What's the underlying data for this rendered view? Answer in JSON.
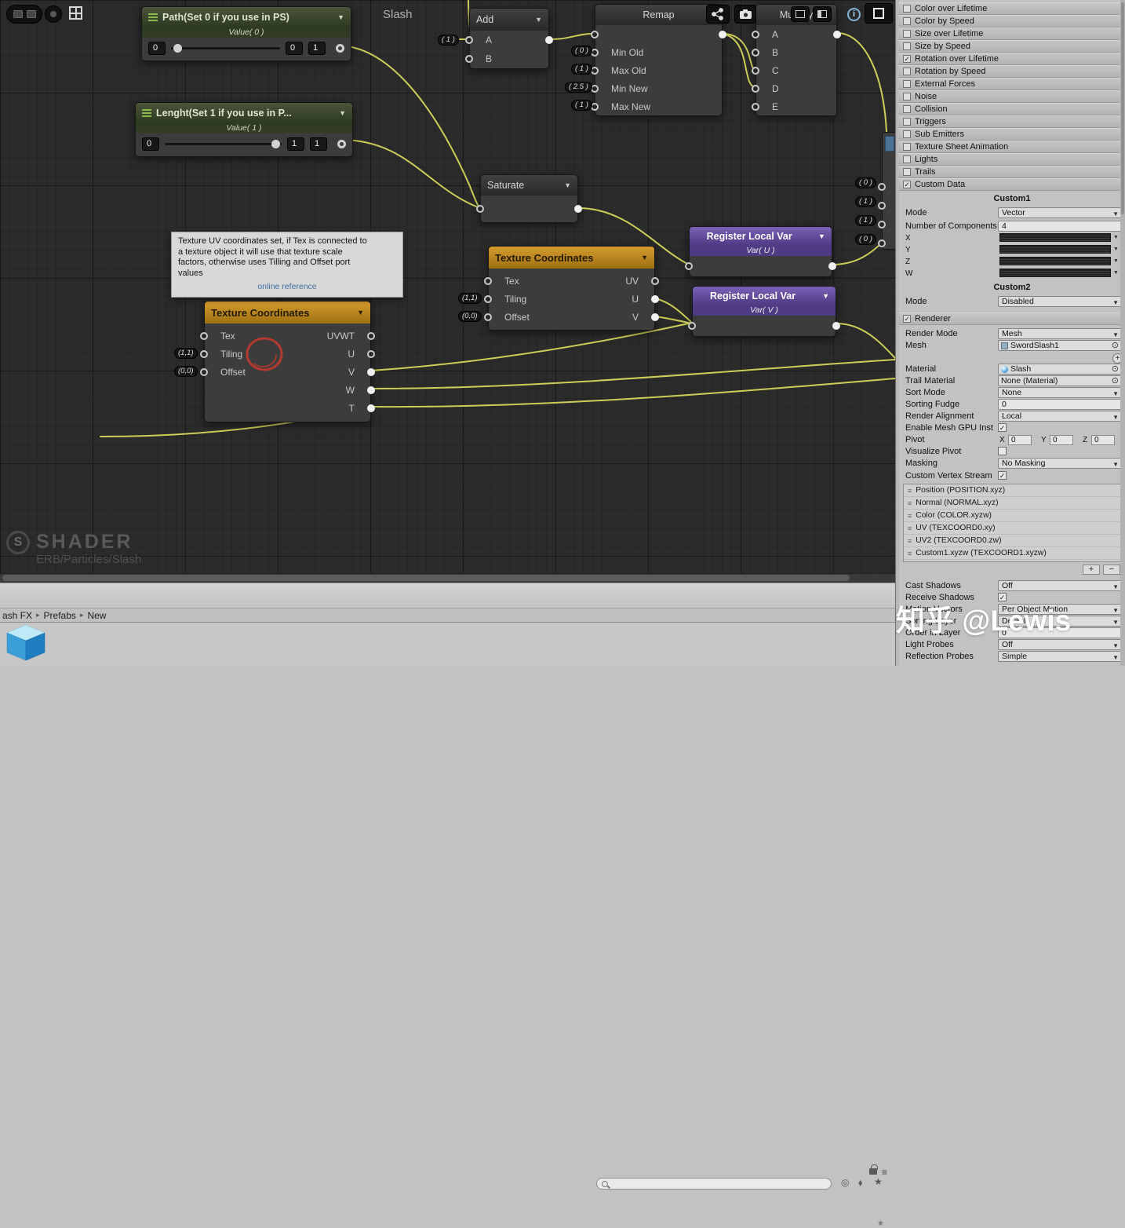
{
  "canvas": {
    "title": "Slash",
    "watermark": {
      "logo": "S",
      "title": "SHADER",
      "subtitle": "ERB/Particles/Slash"
    },
    "tooltip": {
      "line1": "Texture UV coordinates set, if Tex is connected to",
      "line2": "a texture object it will use that texture scale",
      "line3": "factors, otherwise uses Tilling and Offset port",
      "line4": "values",
      "link": "online reference"
    },
    "nodes": {
      "path": {
        "title": "Path(Set 0 if you use in PS)",
        "subtitle": "Value( 0 )",
        "v1": "0",
        "v2": "0",
        "v3": "1"
      },
      "length": {
        "title": "Lenght(Set 1 if you use in P...",
        "subtitle": "Value( 1 )",
        "v1": "0",
        "v2": "1",
        "v3": "1"
      },
      "add": {
        "title": "Add",
        "in1": "A",
        "in2": "B",
        "badge": "( 1 )"
      },
      "remap": {
        "title": "Remap",
        "in1": "Min Old",
        "in2": "Max Old",
        "in3": "Min New",
        "in4": "Max New",
        "b1": "( 0 )",
        "b2": "( 1 )",
        "b3": "( 2.5 )",
        "b4": "( 1 )"
      },
      "multiply": {
        "title": "Multiply",
        "in1": "A",
        "in2": "B",
        "in3": "C",
        "in4": "D",
        "in5": "E"
      },
      "saturate": {
        "title": "Saturate"
      },
      "tex_small": {
        "title": "Texture Coordinates",
        "in1": "Tex",
        "in2": "Tiling",
        "in3": "Offset",
        "out1": "UV",
        "out2": "U",
        "out3": "V",
        "b1": "(1,1)",
        "b2": "(0,0)"
      },
      "tex_large": {
        "title": "Texture Coordinates",
        "in1": "Tex",
        "in2": "Tiling",
        "in3": "Offset",
        "out1": "UVWT",
        "out2": "U",
        "out3": "V",
        "out4": "W",
        "out5": "T",
        "b1": "(1,1)",
        "b2": "(0,0)"
      },
      "reg_u": {
        "title": "Register Local Var",
        "subtitle": "Var( U )"
      },
      "reg_v": {
        "title": "Register Local Var",
        "subtitle": "Var( V )"
      },
      "side": {
        "b1": "( 0 )",
        "b2": "( 1 )",
        "b3": "( 1 )",
        "b4": "( 0 )"
      }
    }
  },
  "inspector": {
    "modules": [
      {
        "label": "Color over Lifetime",
        "check": ""
      },
      {
        "label": "Color by Speed",
        "check": ""
      },
      {
        "label": "Size over Lifetime",
        "check": ""
      },
      {
        "label": "Size by Speed",
        "check": ""
      },
      {
        "label": "Rotation over Lifetime",
        "check": "✓"
      },
      {
        "label": "Rotation by Speed",
        "check": ""
      },
      {
        "label": "External Forces",
        "check": ""
      },
      {
        "label": "Noise",
        "check": ""
      },
      {
        "label": "Collision",
        "check": ""
      },
      {
        "label": "Triggers",
        "check": ""
      },
      {
        "label": "Sub Emitters",
        "check": ""
      },
      {
        "label": "Texture Sheet Animation",
        "check": ""
      },
      {
        "label": "Lights",
        "check": ""
      },
      {
        "label": "Trails",
        "check": ""
      },
      {
        "label": "Custom Data",
        "check": "✓"
      }
    ],
    "custom_data": {
      "custom1_title": "Custom1",
      "mode1_label": "Mode",
      "mode1_value": "Vector",
      "components_label": "Number of Components",
      "components_value": "4",
      "x_label": "X",
      "y_label": "Y",
      "z_label": "Z",
      "w_label": "W",
      "custom2_title": "Custom2",
      "mode2_label": "Mode",
      "mode2_value": "Disabled"
    },
    "renderer": {
      "title": "Renderer",
      "check": "✓",
      "render_mode_label": "Render Mode",
      "render_mode_value": "Mesh",
      "mesh_label": "Mesh",
      "mesh_value": "SwordSlash1",
      "material_label": "Material",
      "material_value": "Slash",
      "trail_material_label": "Trail Material",
      "trail_material_value": "None (Material)",
      "sort_mode_label": "Sort Mode",
      "sort_mode_value": "None",
      "sorting_fudge_label": "Sorting Fudge",
      "sorting_fudge_value": "0",
      "render_alignment_label": "Render Alignment",
      "render_alignment_value": "Local",
      "gpu_instancing_label": "Enable Mesh GPU Inst",
      "gpu_instancing_check": "✓",
      "pivot_label": "Pivot",
      "pivot_x_label": "X",
      "pivot_x": "0",
      "pivot_y_label": "Y",
      "pivot_y": "0",
      "pivot_z_label": "Z",
      "pivot_z": "0",
      "visualize_pivot_label": "Visualize Pivot",
      "masking_label": "Masking",
      "masking_value": "No Masking",
      "custom_vertex_stream_label": "Custom Vertex Stream",
      "custom_vertex_stream_check": "✓",
      "streams": [
        "Position (POSITION.xyz)",
        "Normal (NORMAL.xyz)",
        "Color (COLOR.xyzw)",
        "UV (TEXCOORD0.xy)",
        "UV2 (TEXCOORD0.zw)",
        "Custom1.xyzw (TEXCOORD1.xyzw)"
      ],
      "add_button": "+",
      "remove_button": "−",
      "cast_shadows_label": "Cast Shadows",
      "cast_shadows_value": "Off",
      "receive_shadows_label": "Receive Shadows",
      "receive_shadows_check": "✓",
      "motion_vectors_label": "Motion Vectors",
      "motion_vectors_value": "Per Object Motion",
      "sorting_layer_label": "Sorting Layer",
      "sorting_layer_value": "Default",
      "order_in_layer_label": "Order in Layer",
      "order_in_layer_value": "0",
      "light_probes_label": "Light Probes",
      "light_probes_value": "Off",
      "reflection_probes_label": "Reflection Probes",
      "reflection_probes_value": "Simple"
    }
  },
  "project": {
    "breadcrumb_root": "ash FX",
    "breadcrumb_sep": "▸",
    "breadcrumb_mid": "Prefabs",
    "breadcrumb_leaf": "New"
  },
  "overlay": {
    "zhihu_watermark": "知乎 @Lewis"
  }
}
